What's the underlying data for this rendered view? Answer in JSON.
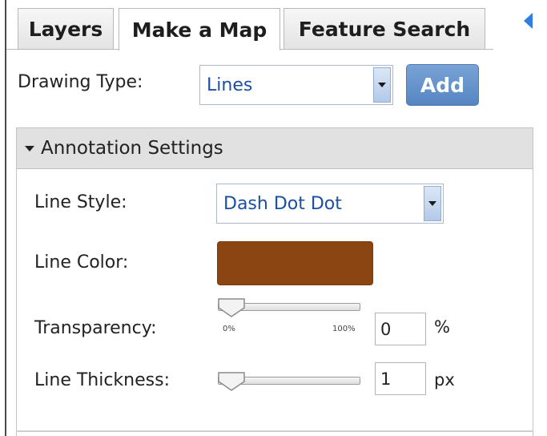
{
  "tabs": [
    {
      "label": "Layers",
      "active": false
    },
    {
      "label": "Make a Map",
      "active": true
    },
    {
      "label": "Feature Search",
      "active": false
    }
  ],
  "collapse_icon": "triangle-left-icon",
  "drawing": {
    "label": "Drawing Type:",
    "value": "Lines",
    "add_label": "Add"
  },
  "annotation": {
    "header": "Annotation Settings",
    "line_style": {
      "label": "Line Style:",
      "value": "Dash Dot Dot"
    },
    "line_color": {
      "label": "Line Color:",
      "color": "#8b4513"
    },
    "transparency": {
      "label": "Transparency:",
      "min_label": "0%",
      "max_label": "100%",
      "value": "0",
      "unit": "%",
      "level": 0
    },
    "line_thickness": {
      "label": "Line Thickness:",
      "value": "1",
      "unit": "px",
      "level": 0
    }
  },
  "colors": {
    "accent": "#5f8ec9",
    "select_text": "#1c4fa0",
    "arrow": "#2f7fe0"
  }
}
